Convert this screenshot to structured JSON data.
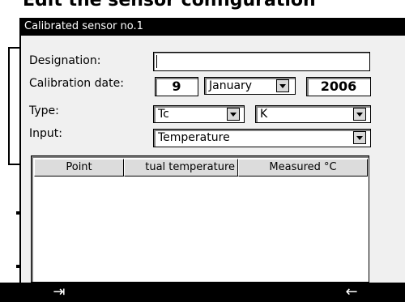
{
  "background": {
    "title_partial": "Edit the sensor configuration"
  },
  "dialog": {
    "title": "Calibrated sensor no.1",
    "fields": {
      "designation": {
        "label": "Designation:",
        "value": ""
      },
      "calibration_date": {
        "label": "Calibration date:",
        "day": "9",
        "month": "January",
        "year": "2006"
      },
      "type": {
        "label": "Type:",
        "value1": "Tc",
        "value2": "K"
      },
      "input": {
        "label": "Input:",
        "value": "Temperature"
      }
    },
    "table": {
      "columns": [
        "Point",
        "tual temperature",
        "Measured °C"
      ],
      "rows": []
    }
  },
  "softkeys": {
    "left": "⇥",
    "right": "←"
  }
}
